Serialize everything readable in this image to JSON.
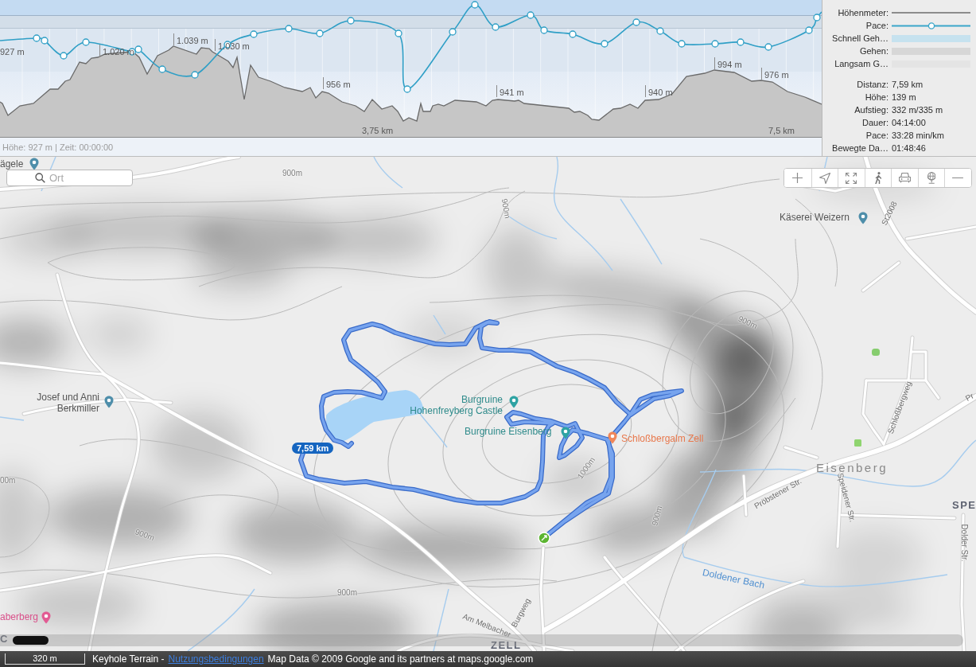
{
  "elevation_chart": {
    "peak_labels": [
      "927 m",
      "1.020 m",
      "1.039 m",
      "1.030 m",
      "956 m",
      "941 m",
      "940 m",
      "994 m",
      "976 m"
    ],
    "distance_labels": [
      "3,75 km",
      "7,5 km"
    ],
    "status": "Höhe: 927 m | Zeit: 00:00:00"
  },
  "legend": {
    "items": [
      {
        "label": "Höhenmeter:",
        "kind": "line",
        "color": "#8c8c8c"
      },
      {
        "label": "Pace:",
        "kind": "marker-line",
        "color": "#3aa6c9"
      },
      {
        "label": "Schnell Geh…",
        "kind": "band",
        "color": "#c6e2ef"
      },
      {
        "label": "Gehen:",
        "kind": "band",
        "color": "#d7d7d7"
      },
      {
        "label": "Langsam G…",
        "kind": "band",
        "color": "#e4e4e4"
      }
    ],
    "stats": [
      {
        "label": "Distanz:",
        "value": "7,59 km"
      },
      {
        "label": "Höhe:",
        "value": "139 m"
      },
      {
        "label": "Aufstieg:",
        "value": "332 m/335 m"
      },
      {
        "label": "Dauer:",
        "value": "04:14:00"
      },
      {
        "label": "Pace:",
        "value": "33:28 min/km"
      },
      {
        "label": "Bewegte Da…",
        "value": "01:48:46"
      }
    ]
  },
  "map": {
    "search": {
      "placeholder": "Ort"
    },
    "labels": [
      {
        "text": "ägele",
        "kind": "place"
      },
      {
        "text": "900m",
        "kind": "contour"
      },
      {
        "text": "900m",
        "kind": "contour"
      },
      {
        "text": "Käserei Weizern",
        "kind": "place"
      },
      {
        "text": "St2008",
        "kind": "road"
      },
      {
        "text": "900m",
        "kind": "contour"
      },
      {
        "text": "Josef und Anni Berkmiller",
        "kind": "place"
      },
      {
        "text": "Burgruine Hohenfreyberg Castle",
        "kind": "poi"
      },
      {
        "text": "Pr",
        "kind": "road"
      },
      {
        "text": "Schloßbergweg",
        "kind": "road"
      },
      {
        "text": "Burgruine Eisenberg",
        "kind": "poi"
      },
      {
        "text": "Schloßbergalm Zell",
        "kind": "restaurant"
      },
      {
        "text": "Eisenberg",
        "kind": "town"
      },
      {
        "text": "1000m",
        "kind": "contour"
      },
      {
        "text": "00m",
        "kind": "contour"
      },
      {
        "text": "Pröbstener Str.",
        "kind": "road"
      },
      {
        "text": "Speidener Str.",
        "kind": "road"
      },
      {
        "text": "SPE",
        "kind": "district"
      },
      {
        "text": "900m",
        "kind": "contour"
      },
      {
        "text": "900m",
        "kind": "contour"
      },
      {
        "text": "Dolder Str.",
        "kind": "road"
      },
      {
        "text": "Doldener Bach",
        "kind": "water"
      },
      {
        "text": "900m",
        "kind": "contour"
      },
      {
        "text": "Burgweg",
        "kind": "road"
      },
      {
        "text": "aberberg",
        "kind": "hotel"
      },
      {
        "text": "Am Melbacher",
        "kind": "road"
      },
      {
        "text": "C",
        "kind": "district"
      },
      {
        "text": "ZELL",
        "kind": "district"
      }
    ],
    "track_badge": "7,59 km"
  },
  "footer": {
    "scale": "320 m",
    "source": "Keyhole Terrain -",
    "link": "Nutzungsbedingungen",
    "attribution": "Map Data © 2009 Google and its partners at maps.google.com"
  }
}
